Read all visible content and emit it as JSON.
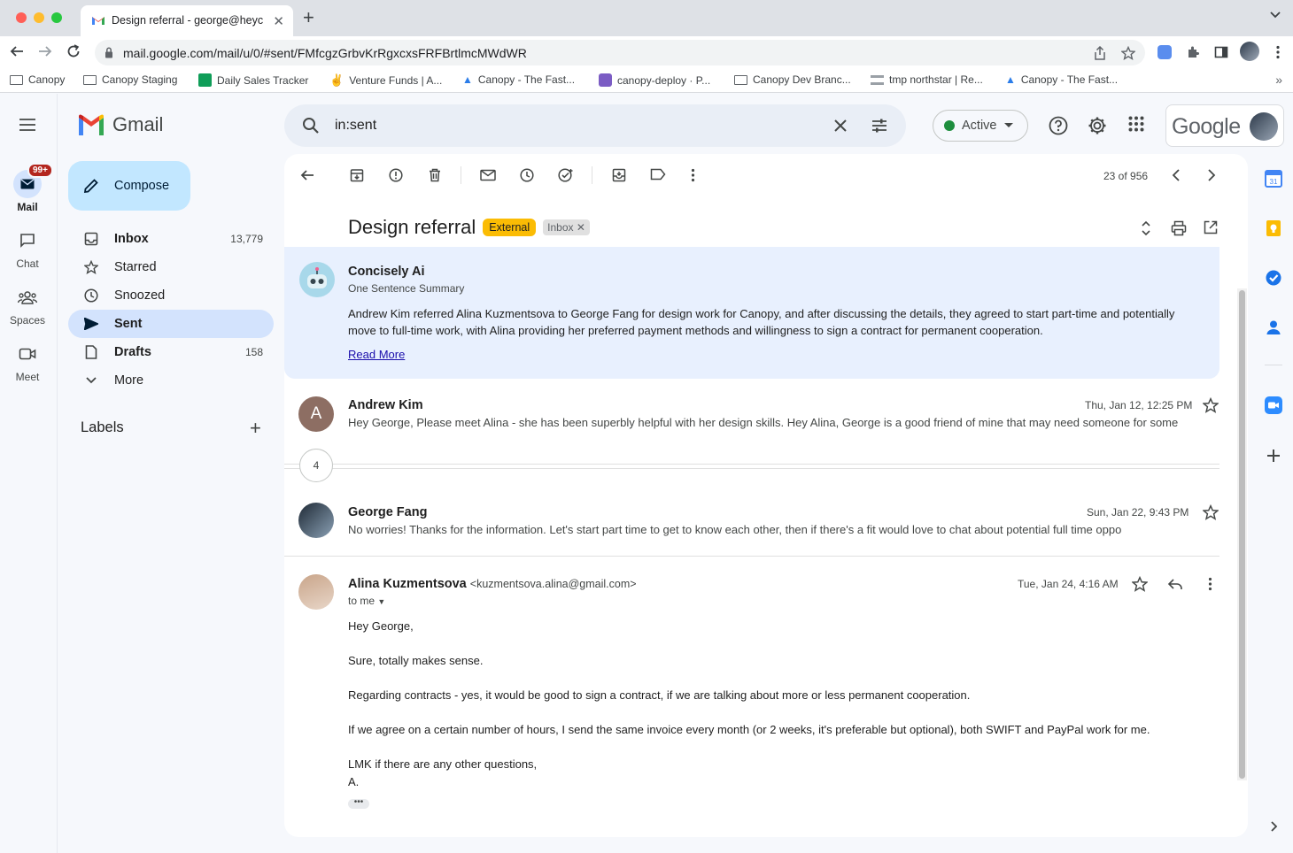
{
  "browser": {
    "tab_title": "Design referral - george@heyc",
    "url": "mail.google.com/mail/u/0/#sent/FMfcgzGrbvKrRgxcxsFRFBrtlmcMWdWR",
    "bookmarks": [
      "Canopy",
      "Canopy Staging",
      "Daily Sales Tracker",
      "Venture Funds | A...",
      "Canopy - The Fast...",
      "canopy-deploy · P...",
      "Canopy Dev Branc...",
      "tmp northstar | Re...",
      "Canopy - The Fast..."
    ],
    "bookmarks_more": "»"
  },
  "rail": {
    "mail": "Mail",
    "mail_badge": "99+",
    "chat": "Chat",
    "spaces": "Spaces",
    "meet": "Meet"
  },
  "gmail": {
    "logo": "Gmail",
    "compose": "Compose",
    "nav": [
      {
        "label": "Inbox",
        "count": "13,779"
      },
      {
        "label": "Starred",
        "count": ""
      },
      {
        "label": "Snoozed",
        "count": ""
      },
      {
        "label": "Sent",
        "count": ""
      },
      {
        "label": "Drafts",
        "count": "158"
      },
      {
        "label": "More",
        "count": ""
      }
    ],
    "labels_heading": "Labels"
  },
  "header": {
    "search_query": "in:sent",
    "status": "Active",
    "google": "Google"
  },
  "thread": {
    "pager": "23 of 956",
    "subject": "Design referral",
    "tag_external": "External",
    "tag_inbox": "Inbox",
    "summary": {
      "name": "Concisely Ai",
      "subtitle": "One Sentence Summary",
      "body": "Andrew Kim referred Alina Kuzmentsova to George Fang for design work for Canopy, and after discussing the details, they agreed to start part-time and potentially move to full-time work, with Alina providing her preferred payment methods and willingness to sign a contract for permanent cooperation.",
      "link": "Read More"
    },
    "messages": [
      {
        "initial": "A",
        "sender": "Andrew Kim",
        "date": "Thu, Jan 12, 12:25 PM",
        "snippet": "Hey George, Please meet Alina - she has been superbly helpful with her design skills. Hey Alina, George is a good friend of mine that may need someone for some"
      },
      {
        "sender": "George Fang",
        "date": "Sun, Jan 22, 9:43 PM",
        "snippet": "No worries! Thanks for the information. Let's start part time to get to know each other, then if there's a fit would love to chat about potential full time oppo"
      }
    ],
    "collapsed_count": "4",
    "open_message": {
      "sender": "Alina Kuzmentsova",
      "email": "<kuzmentsova.alina@gmail.com>",
      "date": "Tue, Jan 24, 4:16 AM",
      "to": "to me",
      "lines": [
        "Hey George,",
        "Sure, totally makes sense.",
        "Regarding contracts - yes, it would be good to sign a contract, if we are talking about more or less permanent cooperation.",
        "If we agree on a certain number of hours, I send the same invoice every month (or 2 weeks, it's preferable but optional), both SWIFT and PayPal work for me.",
        "LMK if there are any other questions,",
        "A."
      ],
      "more": "•••"
    }
  },
  "colors": {
    "accent": "#0b57d0",
    "compose_bg": "#c2e7ff",
    "active_nav": "#d3e3fd",
    "external_tag": "#fbbc04"
  }
}
